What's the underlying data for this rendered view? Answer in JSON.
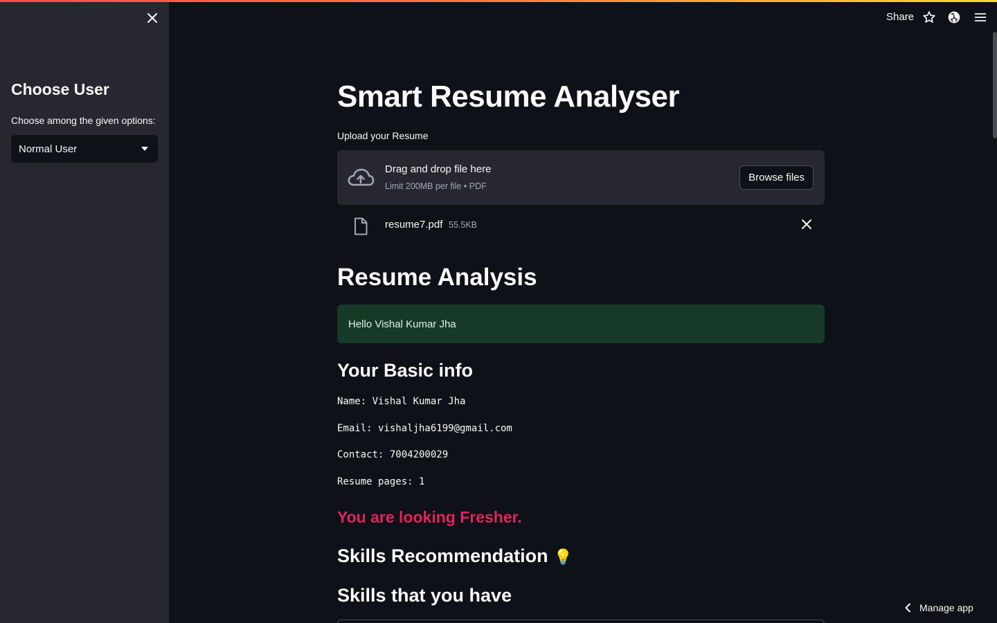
{
  "sidebar": {
    "title": "Choose User",
    "select_label": "Choose among the given options:",
    "select_value": "Normal User"
  },
  "header": {
    "share_label": "Share",
    "icons": [
      "star-icon",
      "github-icon",
      "hamburger-menu-icon"
    ]
  },
  "main": {
    "title": "Smart Resume Analyser",
    "upload_label": "Upload your Resume",
    "dropzone_title": "Drag and drop file here",
    "dropzone_limit": "Limit 200MB per file • PDF",
    "browse_label": "Browse files",
    "file_name": "resume7.pdf",
    "file_size": "55.5KB",
    "analysis_heading": "Resume Analysis",
    "greeting": "Hello Vishal Kumar Jha",
    "basic_info_heading": "Your Basic info",
    "name_line": "Name: Vishal Kumar Jha",
    "email_line": "Email: vishaljha6199@gmail.com",
    "contact_line": "Contact: 7004200029",
    "pages_line": "Resume pages: 1",
    "level_text": "You are looking Fresher.",
    "skills_rec_heading": "Skills Recommendation",
    "skills_rec_emoji": "💡",
    "skills_have_heading": "Skills that you have"
  },
  "footer": {
    "manage_app_label": "Manage app"
  },
  "colors": {
    "background": "#0e1117",
    "sidebar": "#262730",
    "success_bg": "#173928",
    "fresher_text": "#e0245e"
  }
}
